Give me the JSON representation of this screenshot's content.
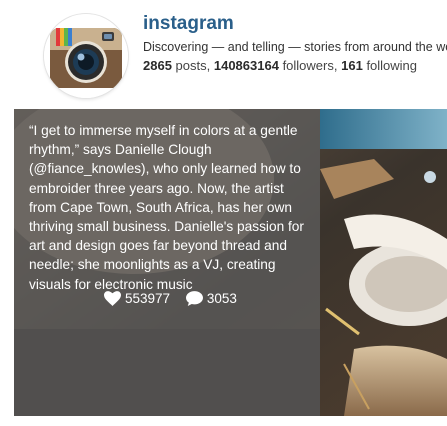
{
  "profile": {
    "username": "instagram",
    "bio": "Discovering — and telling — stories from around the world.",
    "posts_count": "2865",
    "posts_label": "posts,",
    "followers_count": "140863164",
    "followers_label": "followers,",
    "following_count": "161",
    "following_label": "following"
  },
  "post": {
    "caption": "“I get to immerse myself in colors at a gentle rhythm,” says Danielle Clough (@fiance_knowles), who only learned how to embroider three years ago. Now, the artist from Cape Town, South Africa, has her own thriving small business. Danielle's passion for art and design goes far beyond thread and needle; she moonlights as a VJ, creating visuals for electronic music",
    "likes": "553977",
    "comments": "3053"
  },
  "colors": {
    "username": "#2a5f8a",
    "overlay": "rgba(95, 95, 95, 0.72)"
  },
  "icons": {
    "avatar": "instagram-camera-logo",
    "likes": "heart-icon",
    "comments": "speech-bubble-icon"
  }
}
